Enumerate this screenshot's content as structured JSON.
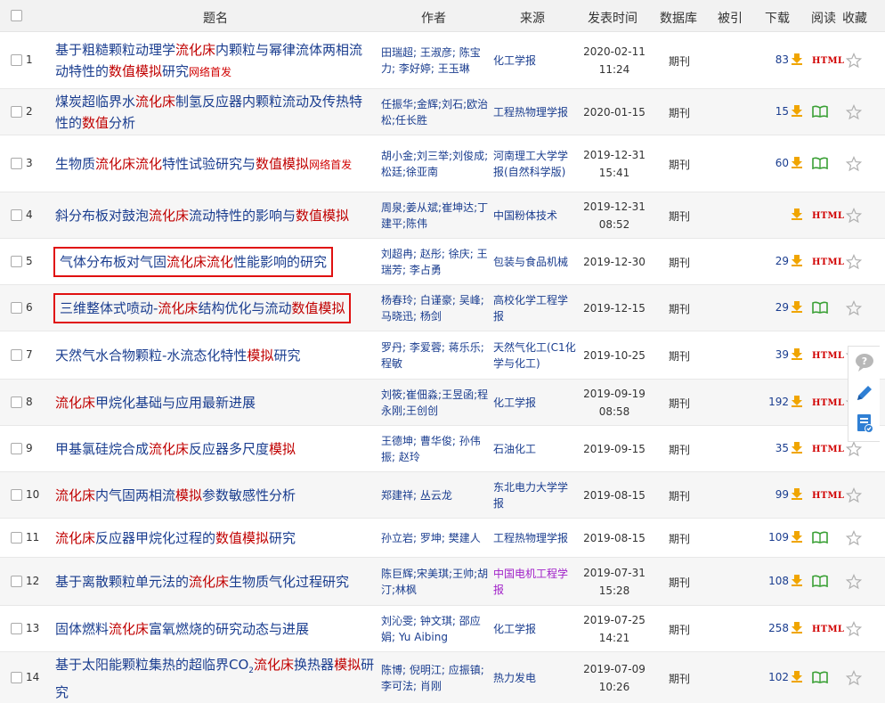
{
  "header": {
    "title": "题名",
    "author": "作者",
    "source": "来源",
    "date": "发表时间",
    "database": "数据库",
    "cited": "被引",
    "download": "下载",
    "read": "阅读",
    "favorite": "收藏"
  },
  "read_icons": {
    "html_label": "HTML",
    "book": "book-icon"
  },
  "rows": [
    {
      "num": "1",
      "title": [
        [
          "基于粗糙颗粒动理学",
          0
        ],
        [
          "流化床",
          1
        ],
        [
          "内颗粒与幂律流体两相流动特性的",
          0
        ],
        [
          "数值模拟",
          1
        ],
        [
          "研究",
          0
        ]
      ],
      "tag": "网络首发",
      "authors": "田瑞超; 王淑彦; 陈宝力; 李好婷; 王玉琳",
      "source": "化工学报",
      "date": "2020-02-11",
      "time": "11:24",
      "db": "期刊",
      "dl": "83",
      "read": "html"
    },
    {
      "num": "2",
      "title": [
        [
          "煤炭超临界水",
          0
        ],
        [
          "流化床",
          1
        ],
        [
          "制氢反应器内颗粒流动及传热特性的",
          0
        ],
        [
          "数值",
          1
        ],
        [
          "分析",
          0
        ]
      ],
      "tag": "",
      "authors": "任振华;金辉;刘石;欧治松;任长胜",
      "source": "工程热物理学报",
      "date": "2020-01-15",
      "time": "",
      "db": "期刊",
      "dl": "15",
      "read": "book"
    },
    {
      "num": "3",
      "title": [
        [
          "生物质",
          0
        ],
        [
          "流化床流化",
          1
        ],
        [
          "特性试验研究与",
          0
        ],
        [
          "数值模拟",
          1
        ]
      ],
      "tag": "网络首发",
      "authors": "胡小金;刘三举;刘俊成;松廷;徐亚南",
      "source": "河南理工大学学报(自然科学版)",
      "date": "2019-12-31",
      "time": "15:41",
      "db": "期刊",
      "dl": "60",
      "read": "book"
    },
    {
      "num": "4",
      "title": [
        [
          "斜分布板对鼓泡",
          0
        ],
        [
          "流化床",
          1
        ],
        [
          "流动特性的影响与",
          0
        ],
        [
          "数值模拟",
          1
        ]
      ],
      "tag": "",
      "authors": "周泉;姜从斌;崔坤达;丁建平;陈伟",
      "source": "中国粉体技术",
      "date": "2019-12-31",
      "time": "08:52",
      "db": "期刊",
      "dl": "",
      "read": "html"
    },
    {
      "num": "5",
      "title": [
        [
          "气体分布板对气固",
          0
        ],
        [
          "流化床流化",
          1
        ],
        [
          "性能影响的研究",
          0
        ]
      ],
      "tag": "",
      "authors": "刘超冉; 赵彤; 徐庆; 王瑞芳; 李占勇",
      "source": "包装与食品机械",
      "date": "2019-12-30",
      "time": "",
      "db": "期刊",
      "dl": "29",
      "read": "html",
      "boxed": true
    },
    {
      "num": "6",
      "title": [
        [
          "三维整体式喷动-",
          0
        ],
        [
          "流化床",
          1
        ],
        [
          "结构优化与流动",
          0
        ],
        [
          "数值模拟",
          1
        ]
      ],
      "tag": "",
      "authors": "杨春玲; 白谨豪; 吴峰; 马晓迅; 杨剑",
      "source": "高校化学工程学报",
      "date": "2019-12-15",
      "time": "",
      "db": "期刊",
      "dl": "29",
      "read": "book",
      "boxed": true
    },
    {
      "num": "7",
      "title": [
        [
          "天然气水合物颗粒-水流态化特性",
          0
        ],
        [
          "模拟",
          1
        ],
        [
          "研究",
          0
        ]
      ],
      "tag": "",
      "authors": "罗丹; 李爱蓉; 蒋乐乐; 程敏",
      "source": "天然气化工(C1化学与化工)",
      "date": "2019-10-25",
      "time": "",
      "db": "期刊",
      "dl": "39",
      "read": "html"
    },
    {
      "num": "8",
      "title": [
        [
          "流化床",
          1
        ],
        [
          "甲烷化基础与应用最新进展",
          0
        ]
      ],
      "tag": "",
      "authors": "刘筱;崔佃淼;王昱函;程永刚;王创创",
      "source": "化工学报",
      "date": "2019-09-19",
      "time": "08:58",
      "db": "期刊",
      "dl": "192",
      "read": "html"
    },
    {
      "num": "9",
      "title": [
        [
          "甲基氯硅烷合成",
          0
        ],
        [
          "流化床",
          1
        ],
        [
          "反应器多尺度",
          0
        ],
        [
          "模拟",
          1
        ]
      ],
      "tag": "",
      "authors": "王德坤; 曹华俊; 孙伟振; 赵玲",
      "source": "石油化工",
      "date": "2019-09-15",
      "time": "",
      "db": "期刊",
      "dl": "35",
      "read": "html"
    },
    {
      "num": "10",
      "title": [
        [
          "流化床",
          1
        ],
        [
          "内气固两相流",
          0
        ],
        [
          "模拟",
          1
        ],
        [
          "参数敏感性分析",
          0
        ]
      ],
      "tag": "",
      "authors": "郑建祥; 丛云龙",
      "source": "东北电力大学学报",
      "date": "2019-08-15",
      "time": "",
      "db": "期刊",
      "dl": "99",
      "read": "html"
    },
    {
      "num": "11",
      "title": [
        [
          "流化床",
          1
        ],
        [
          "反应器甲烷化过程的",
          0
        ],
        [
          "数值模拟",
          1
        ],
        [
          "研究",
          0
        ]
      ],
      "tag": "",
      "authors": "孙立岩; 罗坤; 樊建人",
      "source": "工程热物理学报",
      "date": "2019-08-15",
      "time": "",
      "db": "期刊",
      "dl": "109",
      "read": "book"
    },
    {
      "num": "12",
      "title": [
        [
          "基于离散颗粒单元法的",
          0
        ],
        [
          "流化床",
          1
        ],
        [
          "生物质气化过程研究",
          0
        ]
      ],
      "tag": "",
      "authors": "陈巨辉;宋美琪;王帅;胡汀;林枫",
      "source": "中国电机工程学报",
      "date": "2019-07-31",
      "time": "15:28",
      "db": "期刊",
      "dl": "108",
      "read": "book",
      "purple": true
    },
    {
      "num": "13",
      "title": [
        [
          "固体燃料",
          0
        ],
        [
          "流化床",
          1
        ],
        [
          "富氧燃烧的研究动态与进展",
          0
        ]
      ],
      "tag": "",
      "authors": "刘沁雯; 钟文琪; 邵应娟; Yu Aibing",
      "source": "化工学报",
      "date": "2019-07-25",
      "time": "14:21",
      "db": "期刊",
      "dl": "258",
      "read": "html"
    },
    {
      "num": "14",
      "title": [
        [
          "基于太阳能颗粒集热的超临界CO",
          0
        ],
        [
          "2",
          2
        ],
        [
          "流化床",
          1
        ],
        [
          "换热器",
          0
        ],
        [
          "模拟",
          1
        ],
        [
          "研究",
          0
        ]
      ],
      "tag": "",
      "authors": "陈博; 倪明江; 应振镇; 李可法; 肖刚",
      "source": "热力发电",
      "date": "2019-07-09",
      "time": "10:26",
      "db": "期刊",
      "dl": "102",
      "read": "book"
    }
  ]
}
